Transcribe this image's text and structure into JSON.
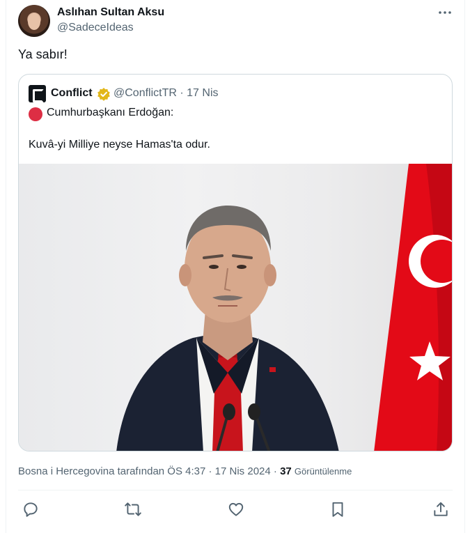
{
  "author": {
    "name": "Aslıhan Sultan Aksu",
    "handle": "@SadeceIdeas"
  },
  "tweet": {
    "text": "Ya sabır!"
  },
  "quoted_tweet": {
    "name": "Conflict",
    "meta": "@ConflictTR · 17 Nis",
    "line1": "Cumhurbaşkanı Erdoğan:",
    "line2": "Kuvâ-yi Milliye neyse Hamas'ta odur."
  },
  "meta": {
    "translated_time": "Bosna i Hercegovina tarafından ÖS 4:37 · 17 Nis 2024 · ",
    "views_count": "37",
    "views_label": "Görüntülenme"
  },
  "colors": {
    "text": "#0f1419",
    "secondary": "#536471",
    "border": "#cfd9de",
    "flag_red": "#e30a17",
    "verified_gold": "#e2b719"
  },
  "icons": {
    "more": "more-icon",
    "reply": "reply-icon",
    "retweet": "retweet-icon",
    "like": "heart-icon",
    "bookmark": "bookmark-icon",
    "share": "share-icon"
  }
}
